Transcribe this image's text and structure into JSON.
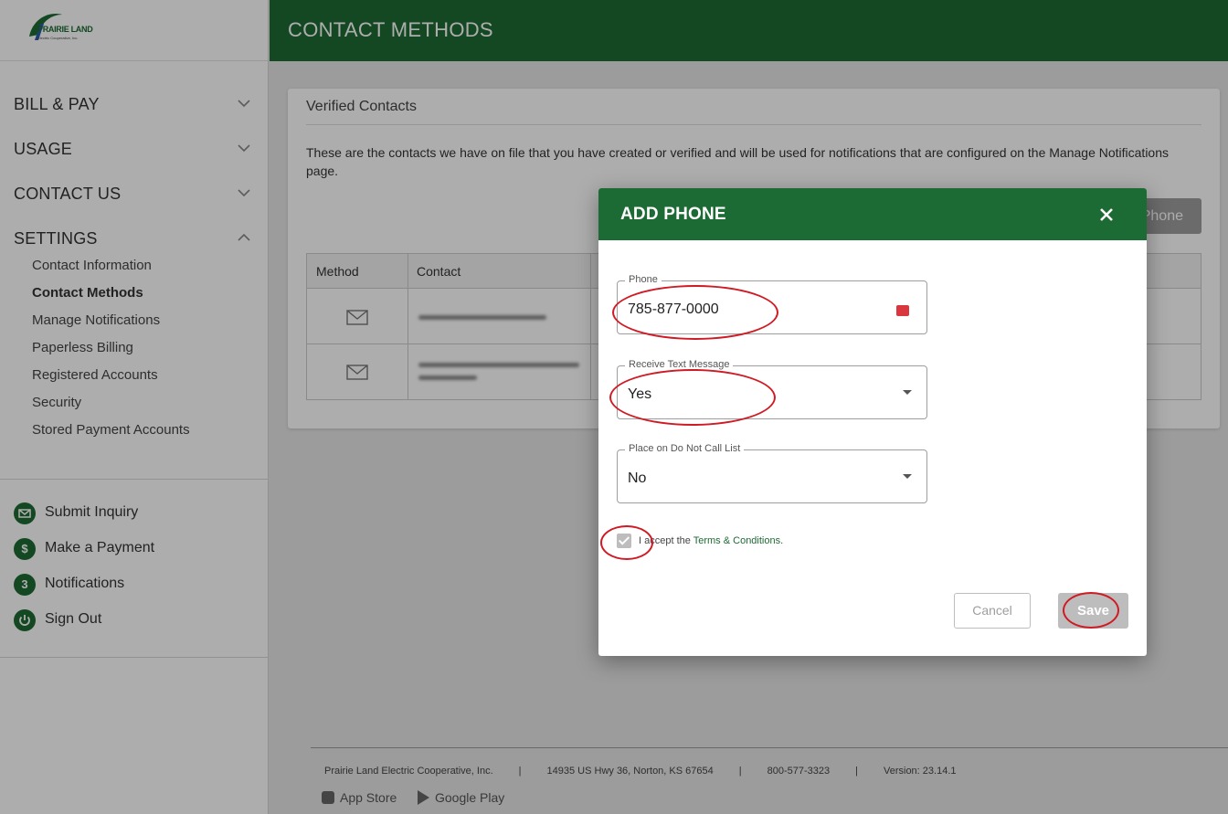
{
  "brand": {
    "logo_text": "PRAIRIE LAND",
    "logo_sub": "Electric Cooperative, Inc.",
    "accent": "#1d6b34"
  },
  "header": {
    "title": "CONTACT METHODS"
  },
  "sidebar": {
    "sections": [
      {
        "label": "BILL & PAY",
        "expanded": false
      },
      {
        "label": "USAGE",
        "expanded": false
      },
      {
        "label": "CONTACT US",
        "expanded": false
      },
      {
        "label": "SETTINGS",
        "expanded": true
      }
    ],
    "settings_items": [
      "Contact Information",
      "Contact Methods",
      "Manage Notifications",
      "Paperless Billing",
      "Registered Accounts",
      "Security",
      "Stored Payment Accounts"
    ],
    "active_item": "Contact Methods",
    "quick_links": [
      {
        "label": "Submit Inquiry",
        "icon": "envelope-icon"
      },
      {
        "label": "Make a Payment",
        "icon": "dollar-icon"
      },
      {
        "label": "Notifications",
        "icon": "notification-count-icon",
        "badge": "3"
      },
      {
        "label": "Sign Out",
        "icon": "power-icon"
      }
    ]
  },
  "card": {
    "title": "Verified Contacts",
    "description": "These are the contacts we have on file that you have created or verified and will be used for notifications that are configured on the Manage Notifications page.",
    "add_button_label": "Phone",
    "table": {
      "headers": [
        "Method",
        "Contact"
      ],
      "rows": [
        {
          "method_icon": "envelope-icon"
        },
        {
          "method_icon": "envelope-icon"
        }
      ]
    }
  },
  "modal": {
    "title": "ADD PHONE",
    "fields": {
      "phone": {
        "label": "Phone",
        "value": "785-877-0000"
      },
      "receive_text": {
        "label": "Receive Text Message",
        "value": "Yes"
      },
      "do_not_call": {
        "label": "Place on Do Not Call List",
        "value": "No"
      }
    },
    "terms": {
      "prefix": "I accept the ",
      "link": "Terms & Conditions",
      "suffix": ".",
      "checked": true
    },
    "cancel_label": "Cancel",
    "save_label": "Save"
  },
  "footer": {
    "company": "Prairie Land Electric Cooperative, Inc.",
    "address": "14935 US Hwy 36, Norton, KS 67654",
    "phone": "800-577-3323",
    "version": "Version: 23.14.1",
    "separator": "|",
    "app_store": "App Store",
    "google_play": "Google Play"
  }
}
